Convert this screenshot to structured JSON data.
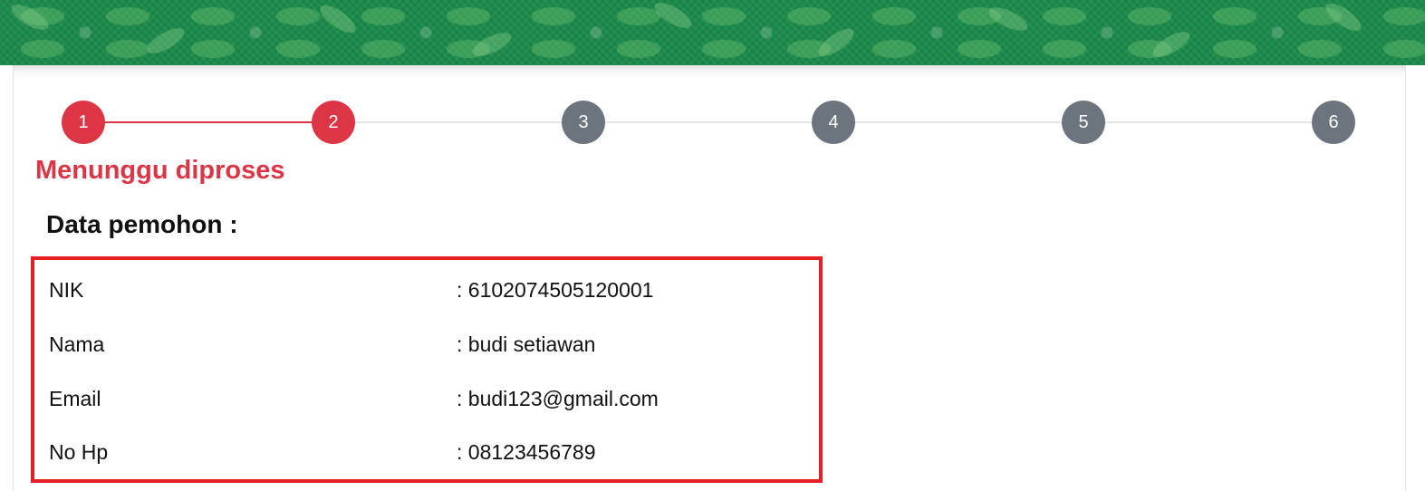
{
  "stepper": {
    "steps": [
      {
        "label": "1",
        "state": "done"
      },
      {
        "label": "2",
        "state": "done"
      },
      {
        "label": "3",
        "state": "pending"
      },
      {
        "label": "4",
        "state": "pending"
      },
      {
        "label": "5",
        "state": "pending"
      },
      {
        "label": "6",
        "state": "pending"
      }
    ],
    "active_color": "#dc3545",
    "pending_color": "#6c757d"
  },
  "status": {
    "title": "Menunggu diproses",
    "color": "#dc3545"
  },
  "applicant": {
    "section_title": "Data pemohon :",
    "fields": [
      {
        "label": "NIK",
        "value": "6102074505120001"
      },
      {
        "label": "Nama",
        "value": "budi setiawan"
      },
      {
        "label": "Email",
        "value": "budi123@gmail.com"
      },
      {
        "label": "No Hp",
        "value": "08123456789"
      }
    ],
    "highlight_color": "#e41e26"
  },
  "banner": {
    "color": "#1b8a4a"
  }
}
